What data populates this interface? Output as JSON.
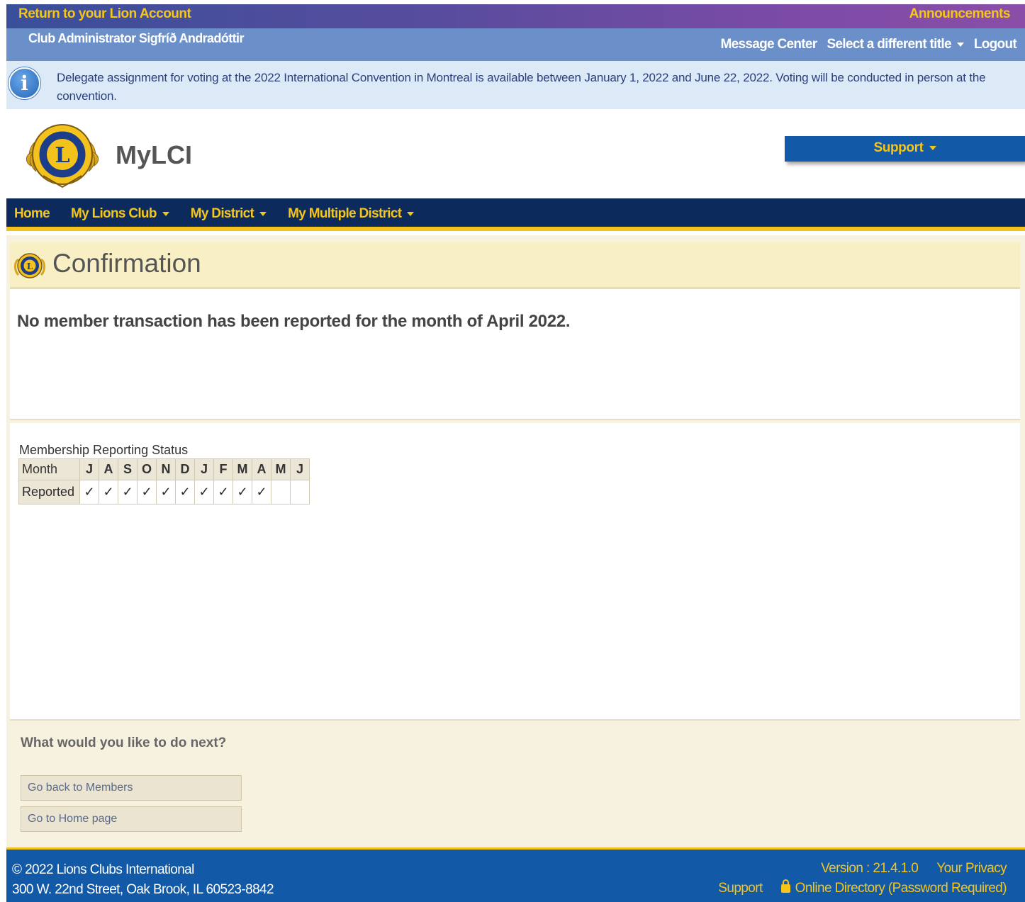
{
  "topbar": {
    "return_link": "Return to your Lion Account",
    "announcements": "Announcements"
  },
  "userbar": {
    "user_title": "Club Administrator Sigfríð Andradóttir",
    "message_center": "Message Center",
    "select_title": "Select a different title",
    "logout": "Logout"
  },
  "info_banner": {
    "icon": "info-icon",
    "message": "Delegate assignment for voting at the 2022 International Convention in Montreal is available between January 1, 2022 and June 22, 2022. Voting will be conducted in person at the convention."
  },
  "header": {
    "brand": "MyLCI",
    "support": "Support",
    "logo": "lions-international-logo"
  },
  "nav": {
    "items": [
      "Home",
      "My Lions Club",
      "My District",
      "My Multiple District"
    ]
  },
  "page": {
    "title": "Confirmation",
    "message": "No member transaction has been reported for the month of April 2022."
  },
  "status": {
    "title": "Membership Reporting Status",
    "month_label": "Month",
    "reported_label": "Reported",
    "months": [
      "J",
      "A",
      "S",
      "O",
      "N",
      "D",
      "J",
      "F",
      "M",
      "A",
      "M",
      "J"
    ],
    "reported": [
      "✓",
      "✓",
      "✓",
      "✓",
      "✓",
      "✓",
      "✓",
      "✓",
      "✓",
      "✓",
      "",
      ""
    ]
  },
  "next": {
    "heading": "What would you like to do next?",
    "buttons": [
      "Go back to Members",
      "Go to Home page"
    ]
  },
  "footer": {
    "copyright": "© 2022 Lions Clubs International",
    "address": "300 W. 22nd Street, Oak Brook, IL 60523-8842",
    "version": "Version : 21.4.1.0",
    "privacy": "Your Privacy",
    "support": "Support",
    "directory": "Online Directory (Password Required)"
  },
  "colors": {
    "brand_blue": "#1259a8",
    "navy": "#0c2a5c",
    "gold": "#f5c518",
    "purple": "#7a4ba6"
  }
}
